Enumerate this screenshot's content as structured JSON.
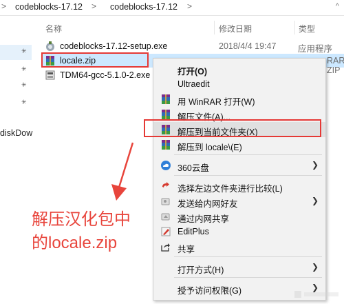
{
  "breadcrumb": {
    "items": [
      "codeblocks-17.12",
      "codeblocks-17.12"
    ],
    "separator": ">",
    "expand": "^"
  },
  "nav": {
    "visible_text": "diskDow"
  },
  "columns": {
    "name": "名称",
    "date": "修改日期",
    "type": "类型"
  },
  "files": [
    {
      "name": "codeblocks-17.12-setup.exe",
      "date": "2018/4/4 19:47",
      "type": "应用程序",
      "icon": "setup-exe-icon"
    },
    {
      "name": "locale.zip",
      "date": "",
      "type": "RAR ZIP",
      "icon": "winrar-archive-icon"
    },
    {
      "name": "TDM64-gcc-5.1.0-2.exe",
      "date": "",
      "type": "",
      "icon": "tdm-gcc-exe-icon"
    }
  ],
  "context_menu": {
    "items": [
      {
        "label": "打开(O)",
        "bold": true
      },
      {
        "label": "Ultraedit"
      },
      {
        "label": "用 WinRAR 打开(W)",
        "icon": "winrar-icon"
      },
      {
        "label": "解压文件(A)...",
        "icon": "winrar-icon"
      },
      {
        "label": "解压到当前文件夹(X)",
        "icon": "winrar-icon"
      },
      {
        "label": "解压到 locale\\(E)",
        "icon": "winrar-icon"
      },
      {
        "label": "360云盘",
        "icon": "cloud-icon",
        "submenu": true
      },
      {
        "label": "选择左边文件夹进行比较(L)",
        "icon": "compare-icon"
      },
      {
        "label": "发送给内网好友",
        "icon": "send-icon",
        "submenu": true
      },
      {
        "label": "通过内网共享",
        "icon": "share-lan-icon"
      },
      {
        "label": "EditPlus",
        "icon": "editplus-icon"
      },
      {
        "label": "共享",
        "icon": "share-icon"
      },
      {
        "label": "打开方式(H)",
        "submenu": true
      },
      {
        "label": "授予访问权限(G)",
        "submenu": true
      }
    ]
  },
  "annotation": {
    "line1": "解压汉化包中",
    "line2": "的locale.zip"
  },
  "colors": {
    "highlight_red": "#e53935",
    "annotation_red": "#e8453c",
    "selection_blue": "#cce8ff",
    "menu_bg": "#f2f2f2"
  }
}
